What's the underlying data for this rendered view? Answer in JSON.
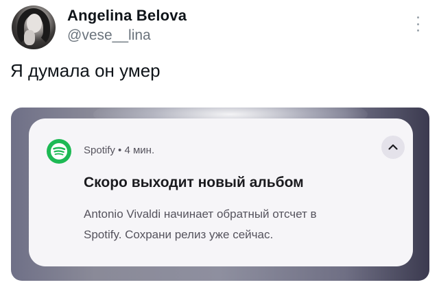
{
  "tweet": {
    "author_name": "Angelina Belova",
    "author_handle": "@vese__lina",
    "text": "Я думала он умер"
  },
  "notification": {
    "app_name": "Spotify",
    "separator": "•",
    "time": "4 мин.",
    "title": "Скоро выходит новый альбом",
    "body_line1": "Antonio Vivaldi начинает обратный отсчет в",
    "body_line2": "Spotify. Сохрани релиз уже сейчас."
  },
  "icons": {
    "avatar": "user-avatar",
    "more": "vertical-ellipsis-icon",
    "app": "spotify-icon",
    "collapse": "chevron-up-icon"
  },
  "colors": {
    "spotify_green": "#1db954",
    "text_primary": "#0f1419",
    "text_secondary": "#6a737c"
  }
}
